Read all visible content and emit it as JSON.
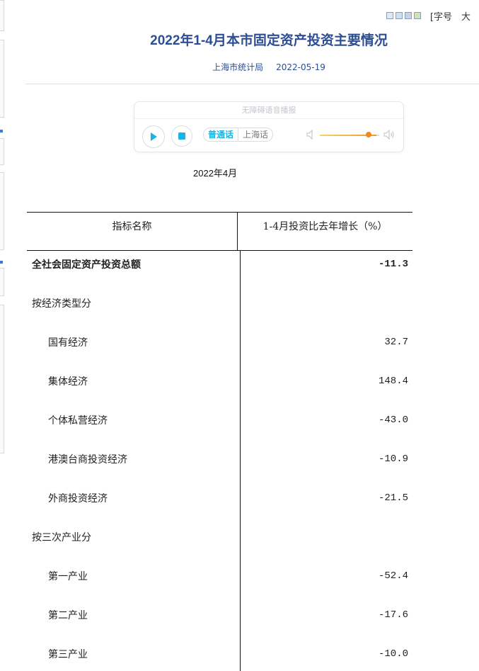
{
  "font_bar": {
    "swatch_colors": [
      "#dfe8f3",
      "#cfdff0",
      "#c7d3e0",
      "#cfe3b4"
    ],
    "label": "[字号",
    "size": "大"
  },
  "article": {
    "title": "2022年1-4月本市固定资产投资主要情况",
    "source": "上海市统计局",
    "date": "2022-05-19",
    "report_period": "2022年4月"
  },
  "player": {
    "title": "无障碍语音播报",
    "lang_active": "普通话",
    "lang_inactive": "上海话",
    "volume": 0.82,
    "accent": "#19b4e6"
  },
  "table": {
    "col1_header": "指标名称",
    "col2_header": "1-4月投资比去年增长（%）",
    "rows": [
      {
        "name": "全社会固定资产投资总额",
        "value": "-11.3",
        "bold": true,
        "indent": 0
      },
      {
        "name": "按经济类型分",
        "value": "",
        "bold": false,
        "indent": 0
      },
      {
        "name": "国有经济",
        "value": "32.7",
        "bold": false,
        "indent": 1
      },
      {
        "name": "集体经济",
        "value": "148.4",
        "bold": false,
        "indent": 1
      },
      {
        "name": "个体私营经济",
        "value": "-43.0",
        "bold": false,
        "indent": 1
      },
      {
        "name": "港澳台商投资经济",
        "value": "-10.9",
        "bold": false,
        "indent": 1
      },
      {
        "name": "外商投资经济",
        "value": "-21.5",
        "bold": false,
        "indent": 1
      },
      {
        "name": "按三次产业分",
        "value": "",
        "bold": false,
        "indent": 0
      },
      {
        "name": "第一产业",
        "value": "-52.4",
        "bold": false,
        "indent": 1
      },
      {
        "name": "第二产业",
        "value": "-17.6",
        "bold": false,
        "indent": 1
      },
      {
        "name": "第三产业",
        "value": "-10.0",
        "bold": false,
        "indent": 1
      }
    ]
  }
}
